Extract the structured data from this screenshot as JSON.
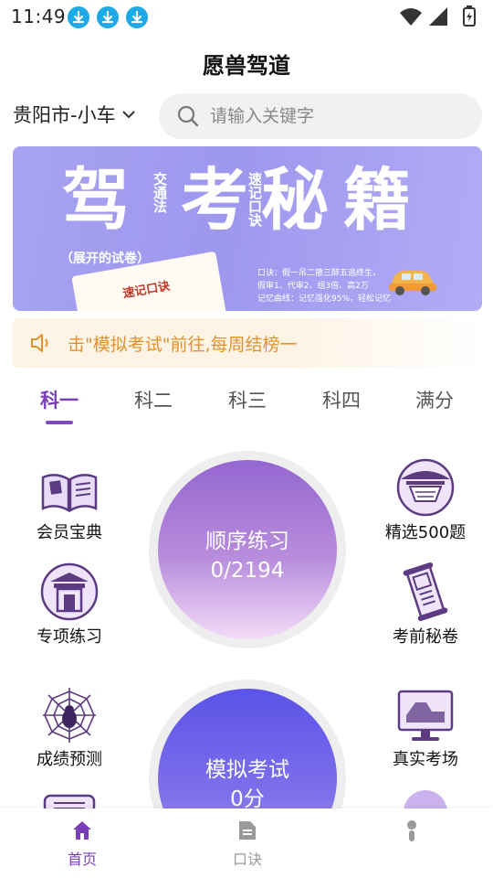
{
  "status_bar": {
    "time": "11:49"
  },
  "header": {
    "title": "愿兽驾道"
  },
  "city": {
    "label": "贵阳市-小车"
  },
  "search": {
    "placeholder": "请输入关键字"
  },
  "banner": {
    "title_chars": [
      "驾",
      "考",
      "秘",
      "籍"
    ],
    "side_text_1": "交通法",
    "side_text_2": "速记口诀",
    "subtitle": "（展开的试卷）",
    "paper_label": "速记口诀",
    "mnemonic_lines": [
      "口诀：假一吊二撤三醉五逃终生，",
      "假审1、代审2、组3倍、高2万",
      "记忆曲线：记忆强化95%，轻松记忆"
    ]
  },
  "notice": {
    "text": "击\"模拟考试\"前往,每周结榜一"
  },
  "tabs": [
    {
      "label": "科一",
      "active": true
    },
    {
      "label": "科二",
      "active": false
    },
    {
      "label": "科三",
      "active": false
    },
    {
      "label": "科四",
      "active": false
    },
    {
      "label": "满分",
      "active": false
    }
  ],
  "features": {
    "member_guide": {
      "label": "会员宝典",
      "icon": "open-book-icon"
    },
    "special_practice": {
      "label": "专项练习",
      "icon": "temple-gate-icon"
    },
    "score_prediction": {
      "label": "成绩预测",
      "icon": "spider-web-icon"
    },
    "selected_500": {
      "label": "精选500题",
      "icon": "pavilion-icon"
    },
    "pre_exam_secrets": {
      "label": "考前秘卷",
      "icon": "scroll-icon"
    },
    "real_exam": {
      "label": "真实考场",
      "icon": "monitor-icon"
    }
  },
  "sequential_practice": {
    "title": "顺序练习",
    "progress": "0/2194"
  },
  "mock_exam": {
    "title": "模拟考试",
    "score": "0分"
  },
  "bottom_nav": [
    {
      "label": "首页",
      "icon": "home-icon",
      "active": true
    },
    {
      "label": "口诀",
      "icon": "document-icon",
      "active": false
    },
    {
      "label": "",
      "icon": "person-icon",
      "active": false
    }
  ],
  "colors": {
    "accent": "#7a3fb8",
    "notice_text": "#e2922c",
    "download_badge": "#1da8e6"
  }
}
